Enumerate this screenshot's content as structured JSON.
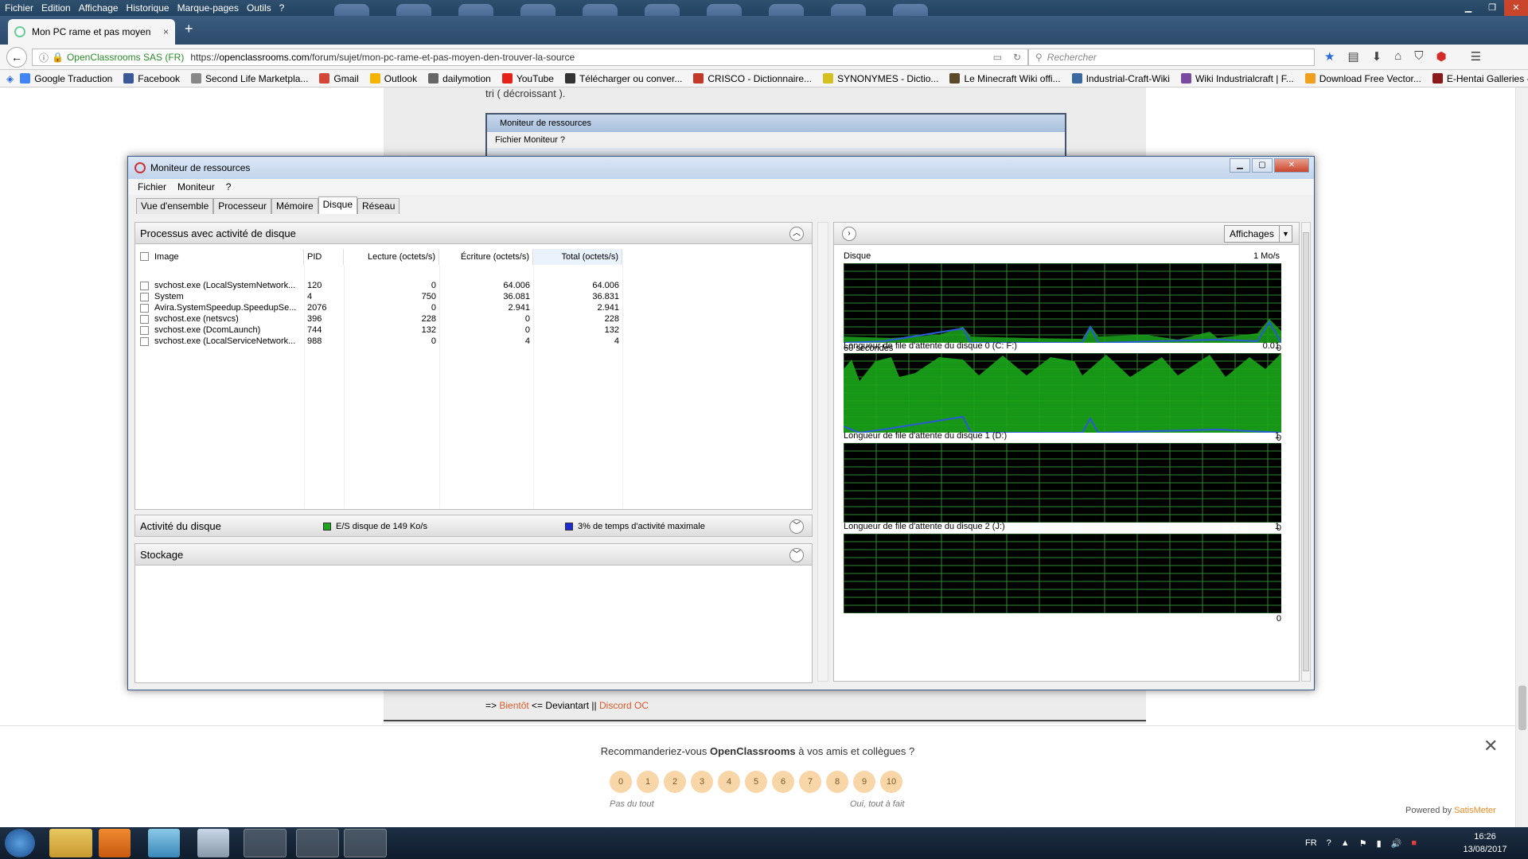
{
  "menubar": {
    "items": [
      "Fichier",
      "Edition",
      "Affichage",
      "Historique",
      "Marque-pages",
      "Outils",
      "?"
    ]
  },
  "tab": {
    "title": "Mon PC rame et pas moyen",
    "close": "×"
  },
  "newtab": "+",
  "nav": {
    "security_label": "OpenClassrooms SAS (FR)",
    "url_prefix": "https://",
    "url_host": "openclassrooms.com",
    "url_path": "/forum/sujet/mon-pc-rame-et-pas-moyen-den-trouver-la-source",
    "search_placeholder": "Rechercher"
  },
  "bookmarks": [
    {
      "label": "Google Traduction",
      "color": "#4285f4"
    },
    {
      "label": "Facebook",
      "color": "#3b5998"
    },
    {
      "label": "Second Life Marketpla...",
      "color": "#888888"
    },
    {
      "label": "Gmail",
      "color": "#d44638"
    },
    {
      "label": "Outlook",
      "color": "#f4b400"
    },
    {
      "label": "dailymotion",
      "color": "#666666"
    },
    {
      "label": "YouTube",
      "color": "#e62117"
    },
    {
      "label": "Télécharger ou conver...",
      "color": "#333333"
    },
    {
      "label": "CRISCO - Dictionnaire...",
      "color": "#c0392b"
    },
    {
      "label": "SYNONYMES - Dictio...",
      "color": "#d4c020"
    },
    {
      "label": "Le Minecraft Wiki offi...",
      "color": "#5a4a2a"
    },
    {
      "label": "Industrial-Craft-Wiki",
      "color": "#3a6aa0"
    },
    {
      "label": "Wiki Industrialcraft | F...",
      "color": "#7a4aa0"
    },
    {
      "label": "Download Free Vector...",
      "color": "#f0a020"
    },
    {
      "label": "E-Hentai Galleries - Th...",
      "color": "#8a1a1a"
    }
  ],
  "page": {
    "partial_text": "tri ( décroissant ).",
    "bg_window_title": "Moniteur de ressources",
    "bg_window_menu": "Fichier   Moniteur   ?",
    "signature": {
      "prefix": "=> ",
      "link1": "Bientôt",
      "middle": " <= Deviantart || ",
      "link2": "Discord OC"
    }
  },
  "survey": {
    "question_pre": "Recommanderiez-vous ",
    "question_brand": "OpenClassrooms",
    "question_post": " à vos amis et collègues ?",
    "scores": [
      "0",
      "1",
      "2",
      "3",
      "4",
      "5",
      "6",
      "7",
      "8",
      "9",
      "10"
    ],
    "label_low": "Pas du tout",
    "label_high": "Oui, tout à fait",
    "close": "✕",
    "powered_pre": "Powered by ",
    "powered_brand": "SatisMeter"
  },
  "rm": {
    "title": "Moniteur de ressources",
    "menu": [
      "Fichier",
      "Moniteur",
      "?"
    ],
    "tabs": [
      "Vue d'ensemble",
      "Processeur",
      "Mémoire",
      "Disque",
      "Réseau"
    ],
    "active_tab": "Disque",
    "proc_section": "Processus avec activité de disque",
    "columns": [
      "Image",
      "PID",
      "Lecture (octets/s)",
      "Écriture (octets/s)",
      "Total (octets/s)"
    ],
    "rows": [
      {
        "image": "svchost.exe (LocalSystemNetwork...",
        "pid": "120",
        "read": "0",
        "write": "64.006",
        "total": "64.006"
      },
      {
        "image": "System",
        "pid": "4",
        "read": "750",
        "write": "36.081",
        "total": "36.831"
      },
      {
        "image": "Avira.SystemSpeedup.SpeedupSe...",
        "pid": "2076",
        "read": "0",
        "write": "2.941",
        "total": "2.941"
      },
      {
        "image": "svchost.exe (netsvcs)",
        "pid": "396",
        "read": "228",
        "write": "0",
        "total": "228"
      },
      {
        "image": "svchost.exe (DcomLaunch)",
        "pid": "744",
        "read": "132",
        "write": "0",
        "total": "132"
      },
      {
        "image": "svchost.exe (LocalServiceNetwork...",
        "pid": "988",
        "read": "0",
        "write": "4",
        "total": "4"
      }
    ],
    "activity_section": "Activité du disque",
    "activity_legend1": "E/S disque de 149 Ko/s",
    "activity_legend2": "3% de temps d'activité maximale",
    "storage_section": "Stockage",
    "affichages": "Affichages",
    "graphs": [
      {
        "title": "Disque",
        "max": "1 Mo/s",
        "sub": "60 secondes",
        "min": "0"
      },
      {
        "title": "Longueur de file d'attente du disque 0 (C: F:)",
        "max": "0.01",
        "sub": "",
        "min": "0"
      },
      {
        "title": "Longueur de file d'attente du disque 1 (D:)",
        "max": "1",
        "sub": "",
        "min": "0"
      },
      {
        "title": "Longueur de file d'attente du disque 2 (J:)",
        "max": "1",
        "sub": "",
        "min": "0"
      }
    ],
    "colors": {
      "green": "#1aa61a",
      "blue": "#2a5bd8",
      "grid": "#2e8a2e"
    }
  },
  "taskbar": {
    "lang": "FR",
    "time": "16:26",
    "date": "13/08/2017"
  }
}
